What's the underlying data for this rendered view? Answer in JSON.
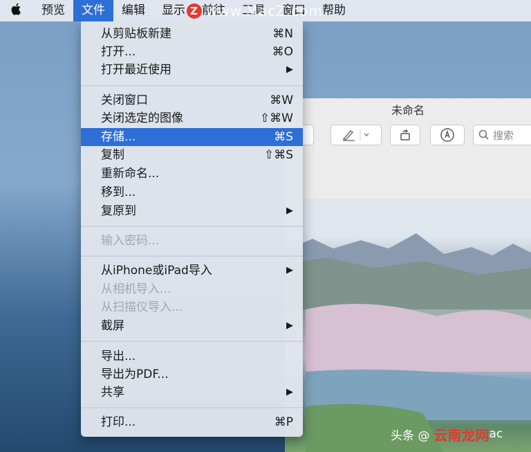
{
  "menubar": {
    "apple": "",
    "items": [
      "预览",
      "文件",
      "编辑",
      "显示",
      "前往",
      "工具",
      "窗口",
      "帮助"
    ],
    "active_index": 1
  },
  "watermark": "www.MacZ.com",
  "window": {
    "title": "未命名",
    "search_placeholder": "搜索"
  },
  "menu": {
    "items": [
      {
        "label": "从剪贴板新建",
        "shortcut": "⌘N"
      },
      {
        "label": "打开...",
        "shortcut": "⌘O"
      },
      {
        "label": "打开最近使用",
        "shortcut": "▶"
      },
      {
        "label": "关闭窗口",
        "shortcut": "⌘W"
      },
      {
        "label": "关闭选定的图像",
        "shortcut": "⇧⌘W"
      },
      {
        "label": "存储...",
        "shortcut": "⌘S"
      },
      {
        "label": "复制",
        "shortcut": "⇧⌘S"
      },
      {
        "label": "重新命名...",
        "shortcut": ""
      },
      {
        "label": "移到...",
        "shortcut": ""
      },
      {
        "label": "复原到",
        "shortcut": "▶"
      },
      {
        "label": "输入密码...",
        "shortcut": ""
      },
      {
        "label": "从iPhone或iPad导入",
        "shortcut": "▶"
      },
      {
        "label": "从相机导入...",
        "shortcut": ""
      },
      {
        "label": "从扫描仪导入...",
        "shortcut": ""
      },
      {
        "label": "截屏",
        "shortcut": "▶"
      },
      {
        "label": "导出...",
        "shortcut": ""
      },
      {
        "label": "导出为PDF...",
        "shortcut": ""
      },
      {
        "label": "共享",
        "shortcut": "▶"
      },
      {
        "label": "打印...",
        "shortcut": "⌘P"
      }
    ]
  },
  "footer": {
    "prefix": "头条 @",
    "brand": "云南龙网",
    "suffix": "ac"
  }
}
